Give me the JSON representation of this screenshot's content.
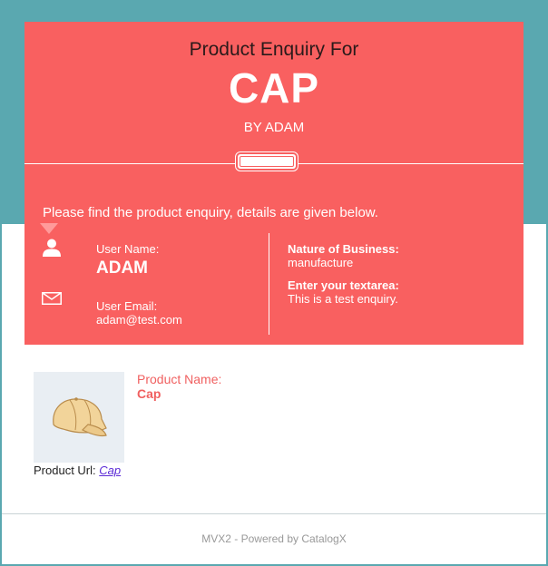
{
  "header": {
    "pre_title": "Product Enquiry For",
    "product_title": "CAP",
    "by_line": "BY ADAM"
  },
  "intro_text": "Please find the product enquiry, details are given below.",
  "user": {
    "name_label": "User Name:",
    "name_value": "ADAM",
    "email_label": "User Email:",
    "email_value": "adam@test.com"
  },
  "extra_fields": {
    "business_label": "Nature of Business:",
    "business_value": "manufacture",
    "textarea_label": "Enter your textarea:",
    "textarea_value": "This is a test enquiry."
  },
  "product": {
    "name_label": "Product Name:",
    "name_value": "Cap",
    "url_label": "Product Url:",
    "url_link_text": "Cap",
    "image_icon": "cap-image"
  },
  "footer": {
    "text": "MVX2 - Powered by CatalogX"
  },
  "colors": {
    "accent": "#f96060",
    "background": "#5aa8b0",
    "link": "#5b2bd6"
  }
}
